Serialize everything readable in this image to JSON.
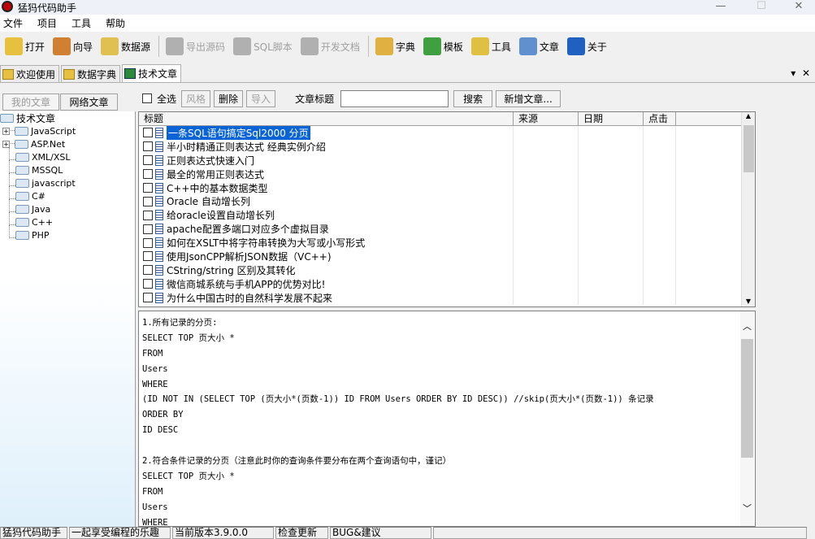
{
  "title": "猛犸代码助手",
  "menu": [
    "文件",
    "项目",
    "工具",
    "帮助"
  ],
  "toolbar": [
    {
      "label": "打开",
      "icon": "folder-open-icon",
      "enabled": true,
      "color": "#e8c040"
    },
    {
      "label": "向导",
      "icon": "wizard-icon",
      "enabled": true,
      "color": "#d08030"
    },
    {
      "label": "数据源",
      "icon": "datasource-icon",
      "enabled": true,
      "color": "#e0c050"
    },
    {
      "label": "导出源码",
      "icon": "export-icon",
      "enabled": false
    },
    {
      "label": "SQL脚本",
      "icon": "sql-script-icon",
      "enabled": false
    },
    {
      "label": "开发文档",
      "icon": "doc-icon",
      "enabled": false
    },
    {
      "label": "字典",
      "icon": "dictionary-icon",
      "enabled": true,
      "color": "#e0b040"
    },
    {
      "label": "模板",
      "icon": "template-icon",
      "enabled": true,
      "color": "#40a040"
    },
    {
      "label": "工具",
      "icon": "tools-icon",
      "enabled": true,
      "color": "#e0c040"
    },
    {
      "label": "文章",
      "icon": "article-icon",
      "enabled": true,
      "color": "#6090d0"
    },
    {
      "label": "关于",
      "icon": "help-icon",
      "enabled": true,
      "color": "#2060c0"
    }
  ],
  "tabs": [
    "欢迎使用",
    "数据字典",
    "技术文章"
  ],
  "left": {
    "subtabs": [
      "我的文章",
      "网络文章"
    ],
    "root": "技术文章",
    "nodes": [
      {
        "label": "JavaScript",
        "expandable": true
      },
      {
        "label": "ASP.Net",
        "expandable": true
      },
      {
        "label": "XML/XSL"
      },
      {
        "label": "MSSQL"
      },
      {
        "label": "javascript"
      },
      {
        "label": "C#"
      },
      {
        "label": "Java"
      },
      {
        "label": "C++"
      },
      {
        "label": "PHP"
      }
    ]
  },
  "articles": {
    "select_all": "全选",
    "style": "风格",
    "delete": "删除",
    "import": "导入",
    "title_label": "文章标题",
    "search_value": "",
    "search": "搜索",
    "new": "新增文章...",
    "columns": [
      "标题",
      "来源",
      "日期",
      "点击"
    ],
    "rows": [
      "一条SQL语句搞定Sql2000 分页",
      "半小时精通正则表达式 经典实例介绍",
      "正则表达式快速入门",
      "最全的常用正则表达式",
      "C++中的基本数据类型",
      "Oracle 自动增长列",
      "给oracle设置自动增长列",
      "apache配置多端口对应多个虚拟目录",
      "如何在XSLT中将字符串转换为大写或小写形式",
      "使用JsonCPP解析JSON数据（VC++)",
      "CString/string 区别及其转化",
      "微信商城系统与手机APP的优势对比!",
      "为什么中国古时的自然科学发展不起来"
    ]
  },
  "content": [
    "1.所有记录的分页:",
    "SELECT TOP 页大小 *",
    "FROM",
    "Users",
    "WHERE",
    "(ID NOT IN (SELECT TOP (页大小*(页数-1)) ID FROM Users ORDER BY ID DESC)) //skip(页大小*(页数-1)) 条记录",
    "ORDER BY",
    "ID DESC",
    "",
    "2.符合条件记录的分页（注意此时你的查询条件要分布在两个查询语句中，谨记）",
    "SELECT TOP 页大小 *",
    "FROM",
    "Users",
    "WHERE"
  ],
  "status": [
    "猛犸代码助手",
    "一起享受编程的乐趣",
    "当前版本3.9.0.0",
    "检查更新",
    "BUG&建议",
    ""
  ]
}
